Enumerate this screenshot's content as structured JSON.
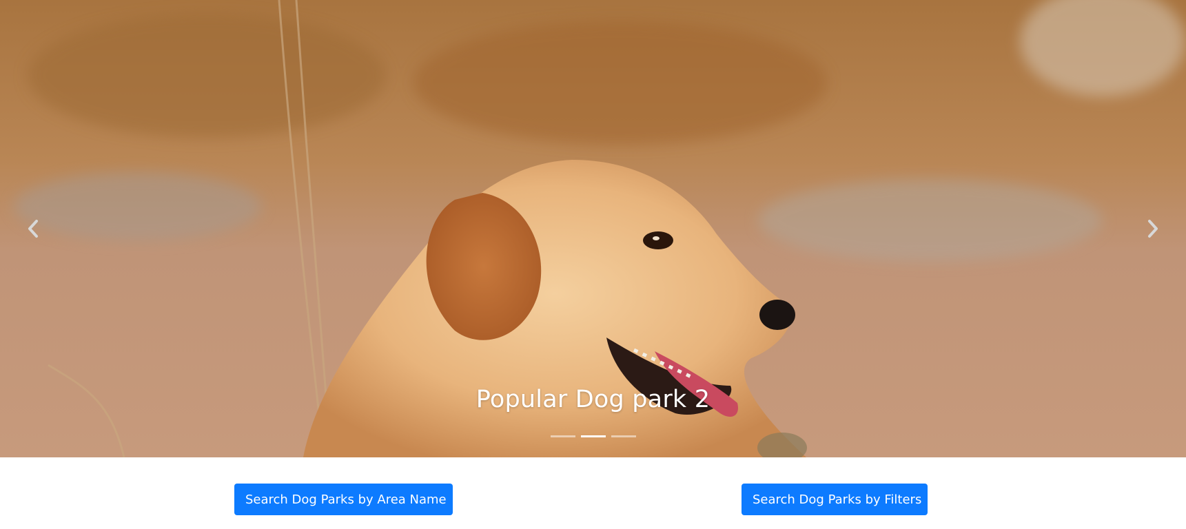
{
  "carousel": {
    "slides": [
      {
        "caption": "Popular Dog park 2",
        "image": "golden-retriever-photo"
      }
    ],
    "active_index": 1,
    "indicator_count": 3,
    "prev_icon": "chevron-left-icon",
    "next_icon": "chevron-right-icon"
  },
  "actions": {
    "search_by_area_label": "Search Dog Parks by Area Name",
    "search_by_filters_label": "Search Dog Parks by Filters"
  },
  "colors": {
    "primary_button": "#0d7bff",
    "caption_text": "#ffffff"
  }
}
